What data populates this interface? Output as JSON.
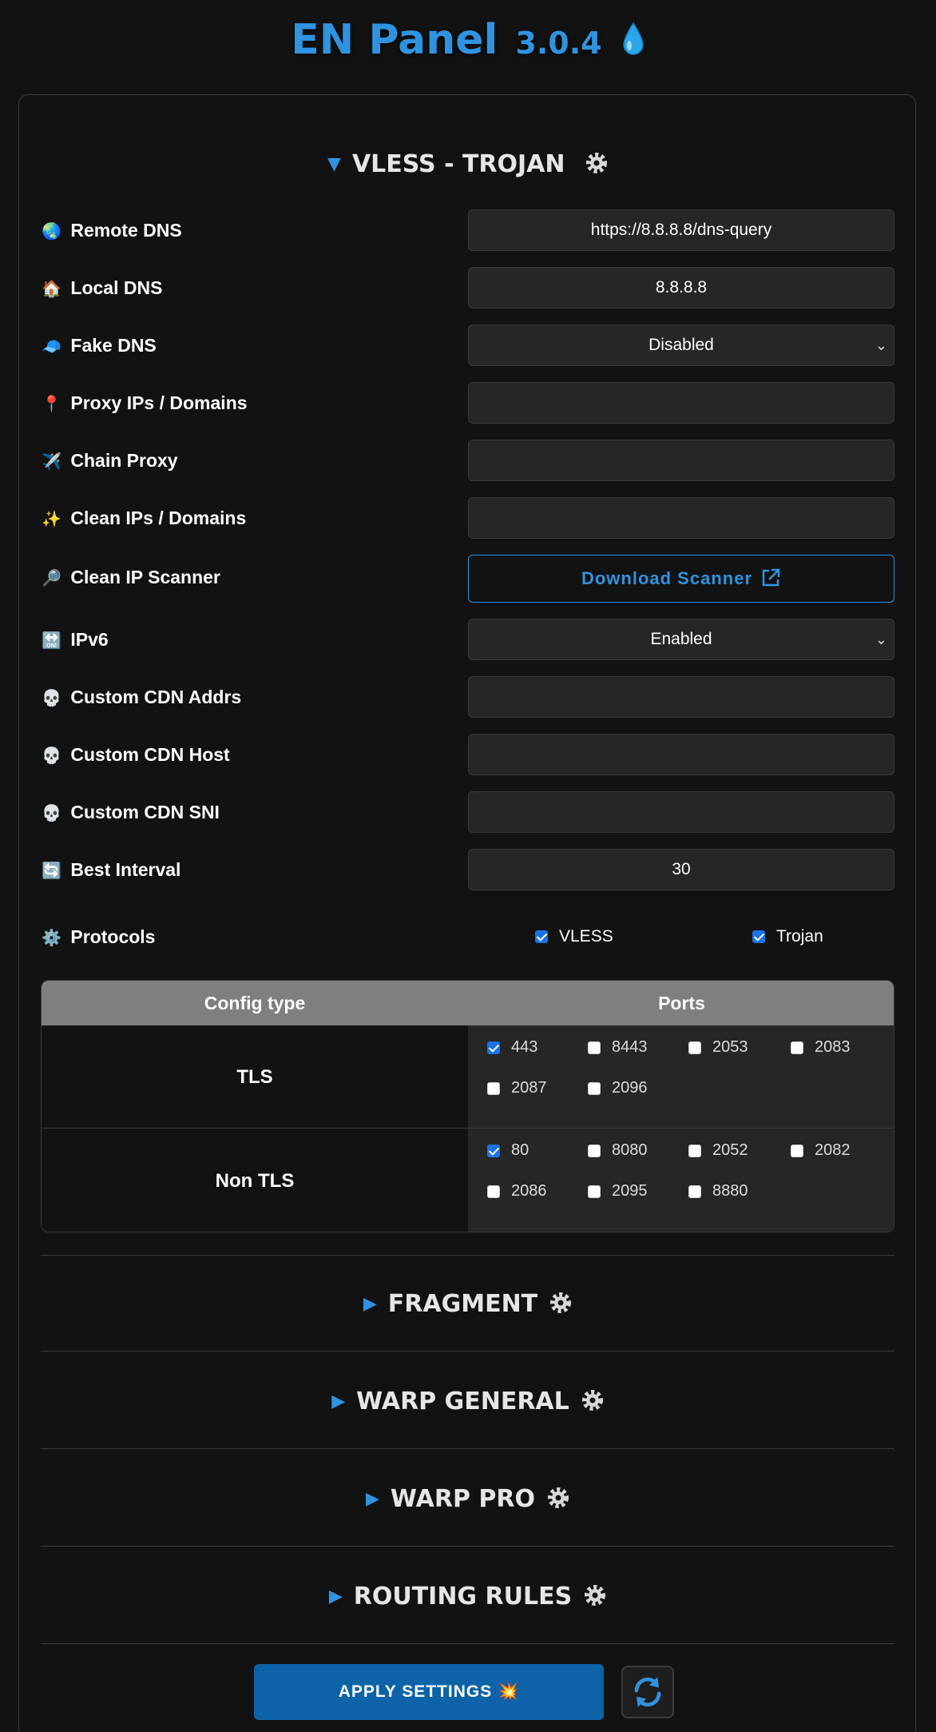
{
  "app": {
    "title": "EN Panel",
    "version": "3.0.4",
    "drop_icon": "water-drop-icon"
  },
  "vless_section": {
    "title": "VLESS - TROJAN",
    "fields": [
      {
        "icon": "globe-icon",
        "glyph": "🌏",
        "label": "Remote DNS",
        "value": "https://8.8.8.8/dns-query"
      },
      {
        "icon": "house-icon",
        "glyph": "🏠",
        "label": "Local DNS",
        "value": "8.8.8.8"
      },
      {
        "icon": "cap-icon",
        "glyph": "🧢",
        "label": "Fake DNS",
        "value": "Disabled"
      },
      {
        "icon": "pin-icon",
        "glyph": "📍",
        "label": "Proxy IPs / Domains",
        "value": ""
      },
      {
        "icon": "airplane-icon",
        "glyph": "✈️",
        "label": "Chain Proxy",
        "value": ""
      },
      {
        "icon": "sparkles-icon",
        "glyph": "✨",
        "label": "Clean IPs / Domains",
        "value": ""
      },
      {
        "icon": "magnifier-icon",
        "glyph": "🔎",
        "label": "Clean IP Scanner",
        "button": "Download Scanner"
      },
      {
        "icon": "on-arrow-icon",
        "glyph": "🔛",
        "label": "IPv6",
        "value": "Enabled"
      },
      {
        "icon": "skull-icon",
        "glyph": "💀",
        "label": "Custom CDN Addrs",
        "value": ""
      },
      {
        "icon": "skull-icon",
        "glyph": "💀",
        "label": "Custom CDN Host",
        "value": ""
      },
      {
        "icon": "skull-icon",
        "glyph": "💀",
        "label": "Custom CDN SNI",
        "value": ""
      },
      {
        "icon": "refresh-icon",
        "glyph": "🔄",
        "label": "Best Interval",
        "value": "30"
      }
    ],
    "protocols": {
      "icon": "gear-icon",
      "glyph": "⚙️",
      "label": "Protocols",
      "options": [
        {
          "label": "VLESS",
          "checked": true
        },
        {
          "label": "Trojan",
          "checked": true
        }
      ]
    },
    "ports_table": {
      "headers": [
        "Config type",
        "Ports"
      ],
      "rows": [
        {
          "name": "TLS",
          "ports": [
            {
              "port": "443",
              "checked": true
            },
            {
              "port": "8443",
              "checked": false
            },
            {
              "port": "2053",
              "checked": false
            },
            {
              "port": "2083",
              "checked": false
            },
            {
              "port": "2087",
              "checked": false
            },
            {
              "port": "2096",
              "checked": false
            }
          ]
        },
        {
          "name": "Non TLS",
          "ports": [
            {
              "port": "80",
              "checked": true
            },
            {
              "port": "8080",
              "checked": false
            },
            {
              "port": "2052",
              "checked": false
            },
            {
              "port": "2082",
              "checked": false
            },
            {
              "port": "2086",
              "checked": false
            },
            {
              "port": "2095",
              "checked": false
            },
            {
              "port": "8880",
              "checked": false
            }
          ]
        }
      ]
    }
  },
  "collapsed_sections": [
    "FRAGMENT",
    "WARP GENERAL",
    "WARP PRO",
    "ROUTING RULES"
  ],
  "footer": {
    "apply_label": "APPLY SETTINGS",
    "apply_emoji": "💥",
    "refresh_icon": "refresh-icon"
  },
  "colors": {
    "accent": "#2f93e0",
    "apply_button": "#0e63a8",
    "background": "#121212",
    "field": "#262626",
    "table_header": "#7f7f7f"
  }
}
